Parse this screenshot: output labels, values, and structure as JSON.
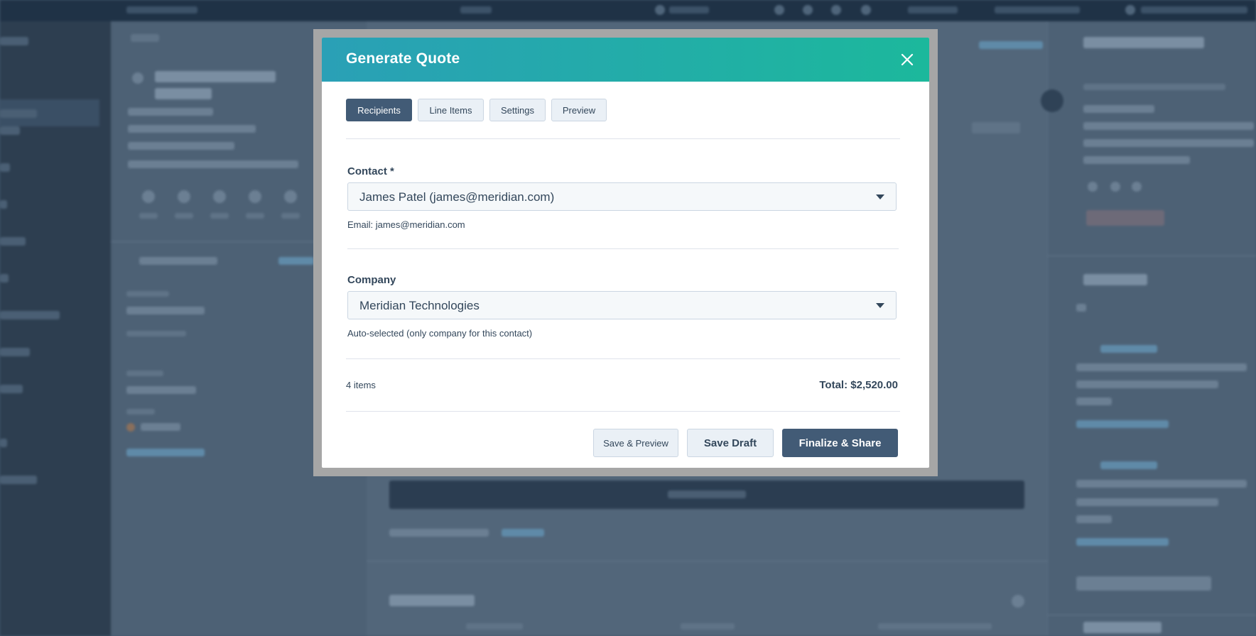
{
  "modal": {
    "title": "Generate Quote",
    "close_label": "×",
    "tabs": [
      {
        "label": "Recipients",
        "active": true
      },
      {
        "label": "Line Items",
        "active": false
      },
      {
        "label": "Settings",
        "active": false
      },
      {
        "label": "Preview",
        "active": false
      }
    ],
    "contact": {
      "label": "Contact *",
      "value": "James Patel (james@meridian.com)",
      "help": "Email: james@meridian.com"
    },
    "company": {
      "label": "Company",
      "value": "Meridian Technologies",
      "help": "Auto-selected (only company for this contact)"
    },
    "summary": {
      "items": "4 items",
      "total": "Total: $2,520.00"
    },
    "buttons": {
      "save_preview": "Save & Preview",
      "save_draft": "Save Draft",
      "finalize": "Finalize & Share"
    }
  },
  "colors": {
    "header_start": "#2aa0b6",
    "header_end": "#1cb89c",
    "primary": "#425b76",
    "secondary_bg": "#eaf0f6",
    "border": "#cbd6e2",
    "text": "#33475b",
    "overlay": "#43586d"
  }
}
